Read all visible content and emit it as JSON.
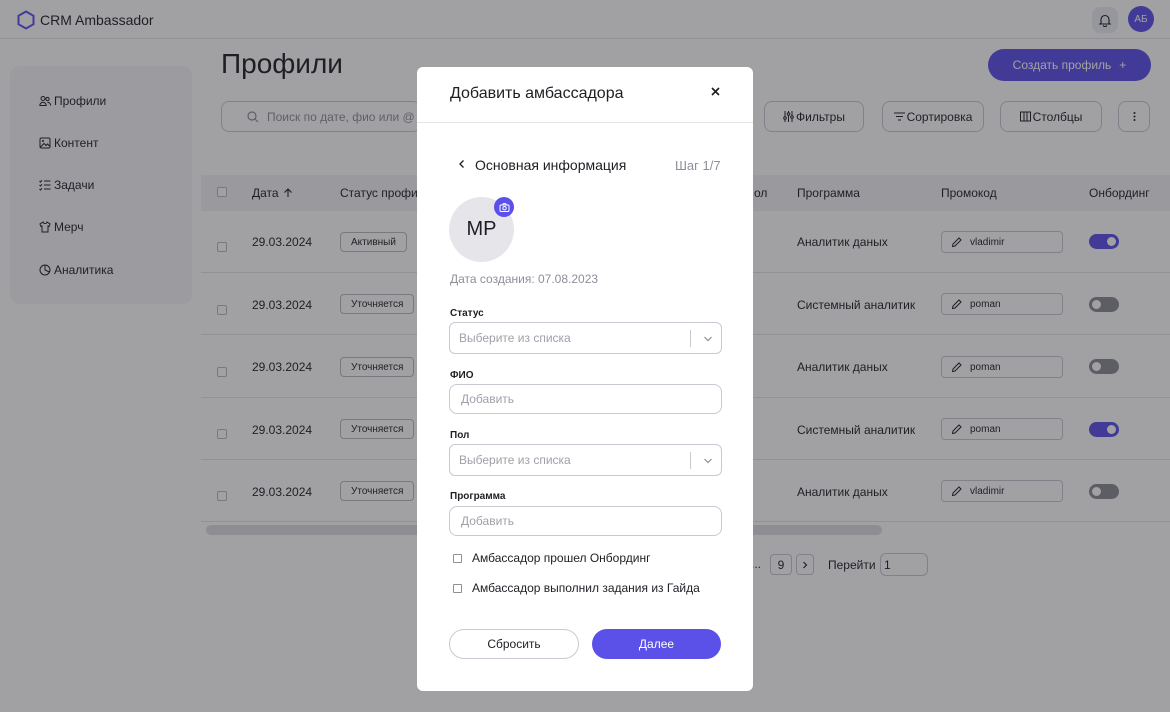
{
  "app": {
    "title": "CRM Ambassador",
    "user_initials": "АБ"
  },
  "sidebar": {
    "items": [
      {
        "label": "Профили",
        "icon": "users-icon"
      },
      {
        "label": "Контент",
        "icon": "image-icon"
      },
      {
        "label": "Задачи",
        "icon": "checklist-icon"
      },
      {
        "label": "Мерч",
        "icon": "tshirt-icon"
      },
      {
        "label": "Аналитика",
        "icon": "pie-chart-icon"
      }
    ]
  },
  "main": {
    "title": "Профили",
    "create_button": "Создать профиль",
    "create_button_icon": "+",
    "search_placeholder": "Поиск по дате, фио или @",
    "toolbar": {
      "filters": "Фильтры",
      "sort": "Сортировка",
      "columns": "Столбцы"
    }
  },
  "table": {
    "headers": [
      "Дата",
      "Статус профи",
      "ол",
      "Программа",
      "Промокод",
      "Онбординг"
    ],
    "rows": [
      {
        "date": "29.03.2024",
        "status": "Активный",
        "program": "Аналитик даных",
        "promo": "vladimir",
        "onboarding": true
      },
      {
        "date": "29.03.2024",
        "status": "Уточняется",
        "program": "Системный аналитик",
        "promo": "роman",
        "onboarding": false
      },
      {
        "date": "29.03.2024",
        "status": "Уточняется",
        "program": "Аналитик даных",
        "promo": "роman",
        "onboarding": false
      },
      {
        "date": "29.03.2024",
        "status": "Уточняется",
        "program": "Системный аналитик",
        "promo": "роman",
        "onboarding": true
      },
      {
        "date": "29.03.2024",
        "status": "Уточняется",
        "program": "Аналитик даных",
        "promo": "vladimir",
        "onboarding": false
      }
    ]
  },
  "pager": {
    "dots": "...",
    "last_page": "9",
    "goto_label": "Перейти",
    "goto_value": "1"
  },
  "modal": {
    "title": "Добавить амбассадора",
    "section": "Основная информация",
    "step": "Шаг 1/7",
    "avatar_initials": "МР",
    "created": "Дата создания: 07.08.2023",
    "fields": {
      "status_label": "Статус",
      "status_placeholder": "Выберите из списка",
      "name_label": "ФИО",
      "name_placeholder": "Добавить",
      "gender_label": "Пол",
      "gender_placeholder": "Выберите из списка",
      "program_label": "Программа",
      "program_placeholder": "Добавить"
    },
    "checkboxes": [
      "Амбассадор прошел Онбординг",
      "Амбассадор выполнил задания из Гайда"
    ],
    "reset_button": "Сбросить",
    "next_button": "Далее"
  },
  "colors": {
    "accent": "#5b50e8",
    "overlay": "rgba(30,30,38,0.42)"
  }
}
